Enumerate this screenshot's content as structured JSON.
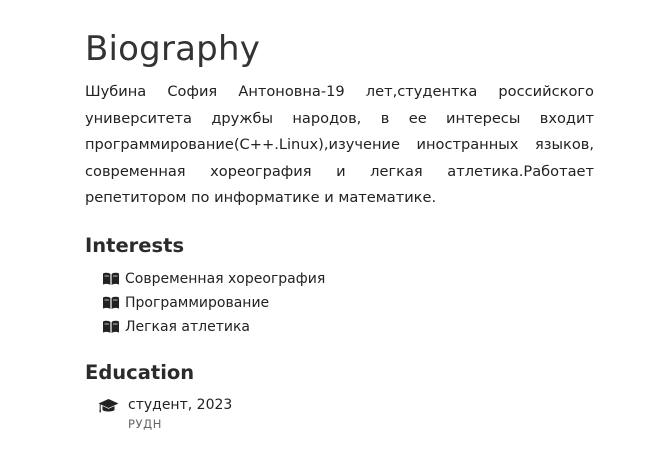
{
  "biography": {
    "title": "Biography",
    "text": "Шубина София Антоновна-19 лет,студентка российского университета дружбы народов, в ее интересы входит программирование(С++.Linux),изучение иностранных языков, современная хореография и легкая атлетика.Работает репетитором по информатике и математике."
  },
  "interests": {
    "title": "Interests",
    "icon": "book-icon",
    "items": [
      {
        "label": "Современная хореография"
      },
      {
        "label": "Программирование"
      },
      {
        "label": "Легкая атлетика"
      }
    ]
  },
  "education": {
    "title": "Education",
    "icon": "graduation-cap-icon",
    "items": [
      {
        "degree": "студент",
        "year": "2023",
        "school": "РУДН"
      }
    ]
  }
}
